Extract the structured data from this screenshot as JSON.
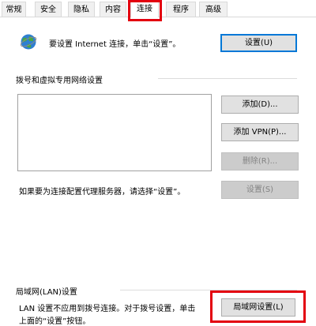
{
  "tabs": [
    {
      "label": "常规"
    },
    {
      "label": "安全"
    },
    {
      "label": "隐私"
    },
    {
      "label": "内容"
    },
    {
      "label": "连接",
      "active": true
    },
    {
      "label": "程序"
    },
    {
      "label": "高级"
    }
  ],
  "setup": {
    "text": "要设置 Internet 连接，单击“设置”。",
    "button": "设置(U)"
  },
  "dialup": {
    "group_title": "拨号和虚拟专用网络设置",
    "add_button": "添加(D)...",
    "add_vpn_button": "添加 VPN(P)...",
    "remove_button": "删除(R)...",
    "proxy_text": "如果要为连接配置代理服务器，请选择“设置”。",
    "settings_button": "设置(S)"
  },
  "lan": {
    "group_title": "局域网(LAN)设置",
    "text_line1": "LAN 设置不应用到拨号连接。对于拨号设置，单击",
    "text_line2": "上面的“设置”按钮。",
    "button": "局域网设置(L)"
  },
  "colors": {
    "highlight": "#e3000f",
    "default_button_border": "#0078d7"
  }
}
